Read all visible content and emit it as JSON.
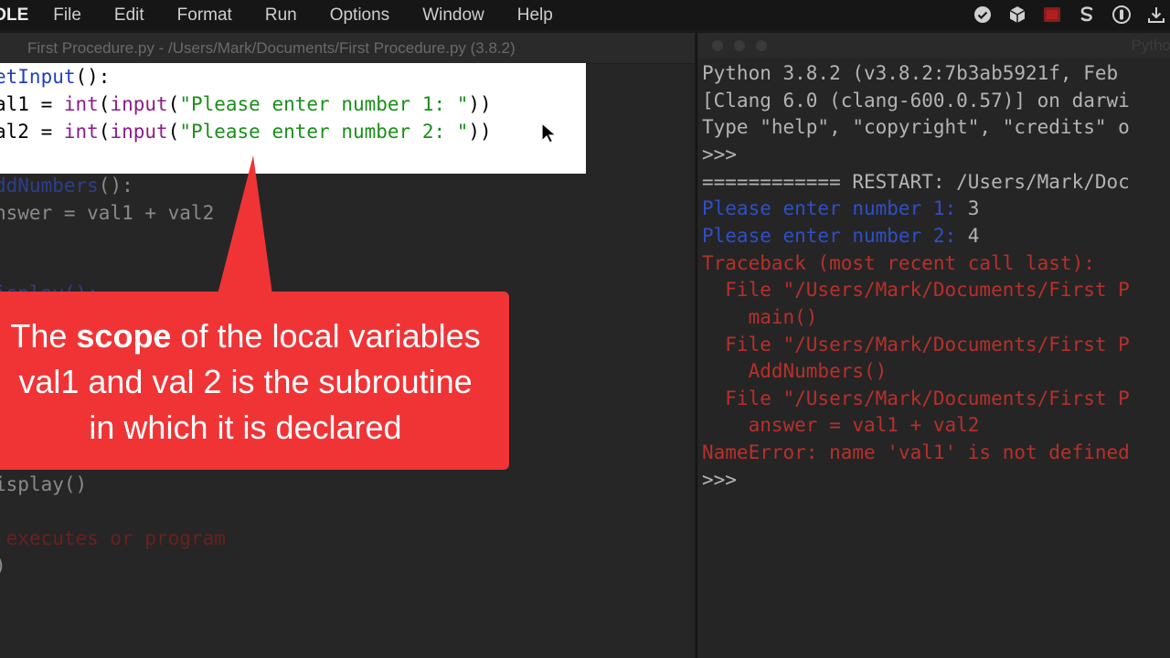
{
  "menubar": {
    "app_name": "IDLE",
    "items": [
      "File",
      "Edit",
      "Format",
      "Run",
      "Options",
      "Window",
      "Help"
    ]
  },
  "editor": {
    "title": "First Procedure.py - /Users/Mark/Documents/First Procedure.py (3.8.2)",
    "snippet": {
      "line1": {
        "def": "etInput",
        "rest": "():"
      },
      "line2": {
        "a": "al1 = ",
        "fn1": "int",
        "p1": "(",
        "fn2": "input",
        "p2": "(",
        "s": "\"Please enter number 1: \"",
        "end": "))"
      },
      "line3": {
        "a": "al2 = ",
        "fn1": "int",
        "p1": "(",
        "fn2": "input",
        "p2": "(",
        "s": "\"Please enter number 2: \"",
        "end": "))"
      }
    },
    "dimmed": {
      "addnumbers_def": "ddNumbers",
      "addnumbers_paren": "():",
      "answer_line": "nswer = val1 + val2",
      "display_partial": "isplay():",
      "display_call": "isplay()",
      "comment_line": " executes or program",
      "trailing": ")"
    }
  },
  "shell": {
    "title": "Pytho",
    "lines": [
      {
        "text": "Python 3.8.2 (v3.8.2:7b3ab5921f, Feb",
        "style": "normal"
      },
      {
        "text": "[Clang 6.0 (clang-600.0.57)] on darwi",
        "style": "normal"
      },
      {
        "text": "Type \"help\", \"copyright\", \"credits\" o",
        "style": "normal"
      },
      {
        "text": ">>>",
        "style": "normal"
      },
      {
        "text": "============ RESTART: /Users/Mark/Doc",
        "style": "normal"
      },
      {
        "text": "Please enter number 1: ",
        "style": "blue",
        "input": "3"
      },
      {
        "text": "Please enter number 2: ",
        "style": "blue",
        "input": "4"
      },
      {
        "text": "Traceback (most recent call last):",
        "style": "red"
      },
      {
        "text": "  File \"/Users/Mark/Documents/First P",
        "style": "red"
      },
      {
        "text": "    main()",
        "style": "red"
      },
      {
        "text": "  File \"/Users/Mark/Documents/First P",
        "style": "red"
      },
      {
        "text": "    AddNumbers()",
        "style": "red"
      },
      {
        "text": "  File \"/Users/Mark/Documents/First P",
        "style": "red"
      },
      {
        "text": "    answer = val1 + val2",
        "style": "red"
      },
      {
        "text": "NameError: name 'val1' is not defined",
        "style": "red"
      },
      {
        "text": ">>>",
        "style": "normal"
      }
    ]
  },
  "callout": {
    "line1_pre": "The ",
    "line1_bold": "scope",
    "line1_post": " of the local variables",
    "line2": "val1 and val 2 is the subroutine",
    "line3": "in which it is declared"
  },
  "colors": {
    "callout_bg": "#f03436",
    "keyword_blue": "#1f3fbf",
    "builtin_purple": "#8b1b8b",
    "string_green": "#1a8f1a",
    "error_red": "#b8302b"
  },
  "icons": [
    "check-circle-icon",
    "cube-icon",
    "record-icon",
    "skype-s-icon",
    "circle-power-icon",
    "download-icon"
  ]
}
